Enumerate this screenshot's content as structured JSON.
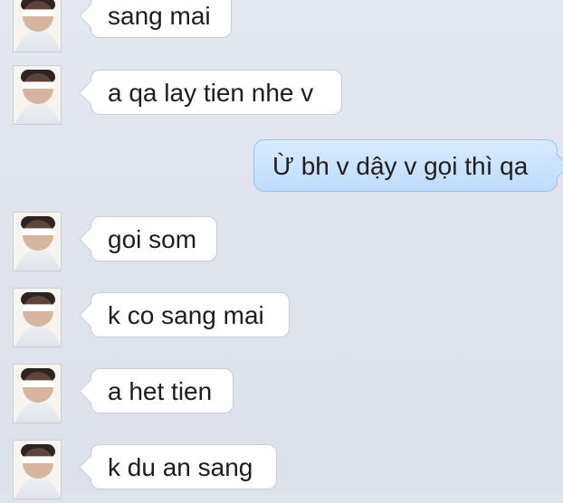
{
  "messages": [
    {
      "from": "contact",
      "text": "sang mai"
    },
    {
      "from": "contact",
      "text": "a qa lay tien nhe v"
    },
    {
      "from": "me",
      "text": "Ừ bh v dậy v gọi thì qa"
    },
    {
      "from": "contact",
      "text": "goi som"
    },
    {
      "from": "contact",
      "text": "k co sang mai"
    },
    {
      "from": "contact",
      "text": "a het tien"
    },
    {
      "from": "contact",
      "text": "k du an sang"
    }
  ]
}
